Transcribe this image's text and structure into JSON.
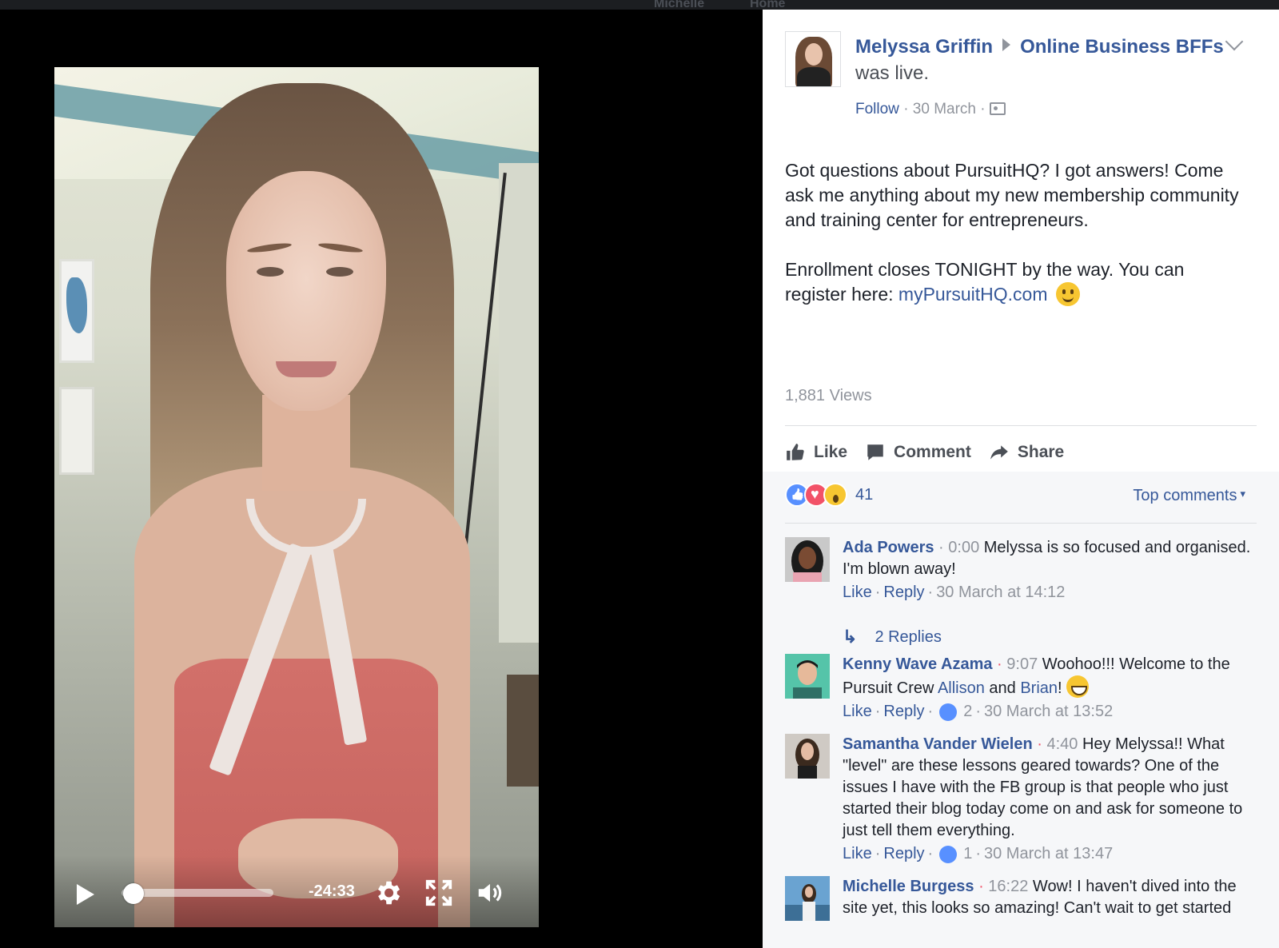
{
  "top_bar": {
    "faded_name": "Michelle",
    "faded_home": "Home"
  },
  "video": {
    "remaining_time": "-24:33",
    "progress_fraction": 0.02,
    "icons": [
      "play-icon",
      "settings-gear-icon",
      "fullscreen-icon",
      "volume-icon"
    ]
  },
  "post": {
    "author": "Melyssa Griffin",
    "group": "Online Business BFFs",
    "status": "was live.",
    "follow_label": "Follow",
    "date": "30 March",
    "body_paragraph_1": "Got questions about PursuitHQ? I got answers! Come ask me anything about my new membership community and training center for entrepreneurs.",
    "body_paragraph_2_prefix": "Enrollment closes TONIGHT by the way. You can register here: ",
    "body_link": "myPursuitHQ.com",
    "views": "1,881 Views"
  },
  "actions": {
    "like": "Like",
    "comment": "Comment",
    "share": "Share"
  },
  "reactions": {
    "count": "41",
    "sort_label": "Top comments"
  },
  "comments": [
    {
      "name": "Ada Powers",
      "time": "0:00",
      "text": "Melyssa is so focused and organised. I'm blown away!",
      "like": "Like",
      "reply": "Reply",
      "date": "30 March at 14:12",
      "replies_label": "2 Replies"
    },
    {
      "name": "Kenny Wave Azama",
      "time": "9:07",
      "text_before": "Woohoo!!! Welcome to the Pursuit Crew ",
      "tag1": "Allison",
      "and": " and ",
      "tag2": "Brian",
      "text_after": "!",
      "like": "Like",
      "reply": "Reply",
      "like_count": "2",
      "date": "30 March at 13:52"
    },
    {
      "name": "Samantha Vander Wielen",
      "time": "4:40",
      "text": "Hey Melyssa!! What \"level\" are these lessons geared towards? One of the issues I have with the FB group is that people who just started their blog today come on and ask for someone to just tell them everything.",
      "like": "Like",
      "reply": "Reply",
      "like_count": "1",
      "date": "30 March at 13:47"
    },
    {
      "name": "Michelle Burgess",
      "time": "16:22",
      "text": "Wow! I haven't dived into the site yet, this looks so amazing! Can't wait to get started"
    }
  ],
  "colors": {
    "link": "#365899",
    "meta": "#90949c",
    "like": "#5890ff",
    "love": "#f25268",
    "wow": "#f7c631"
  }
}
